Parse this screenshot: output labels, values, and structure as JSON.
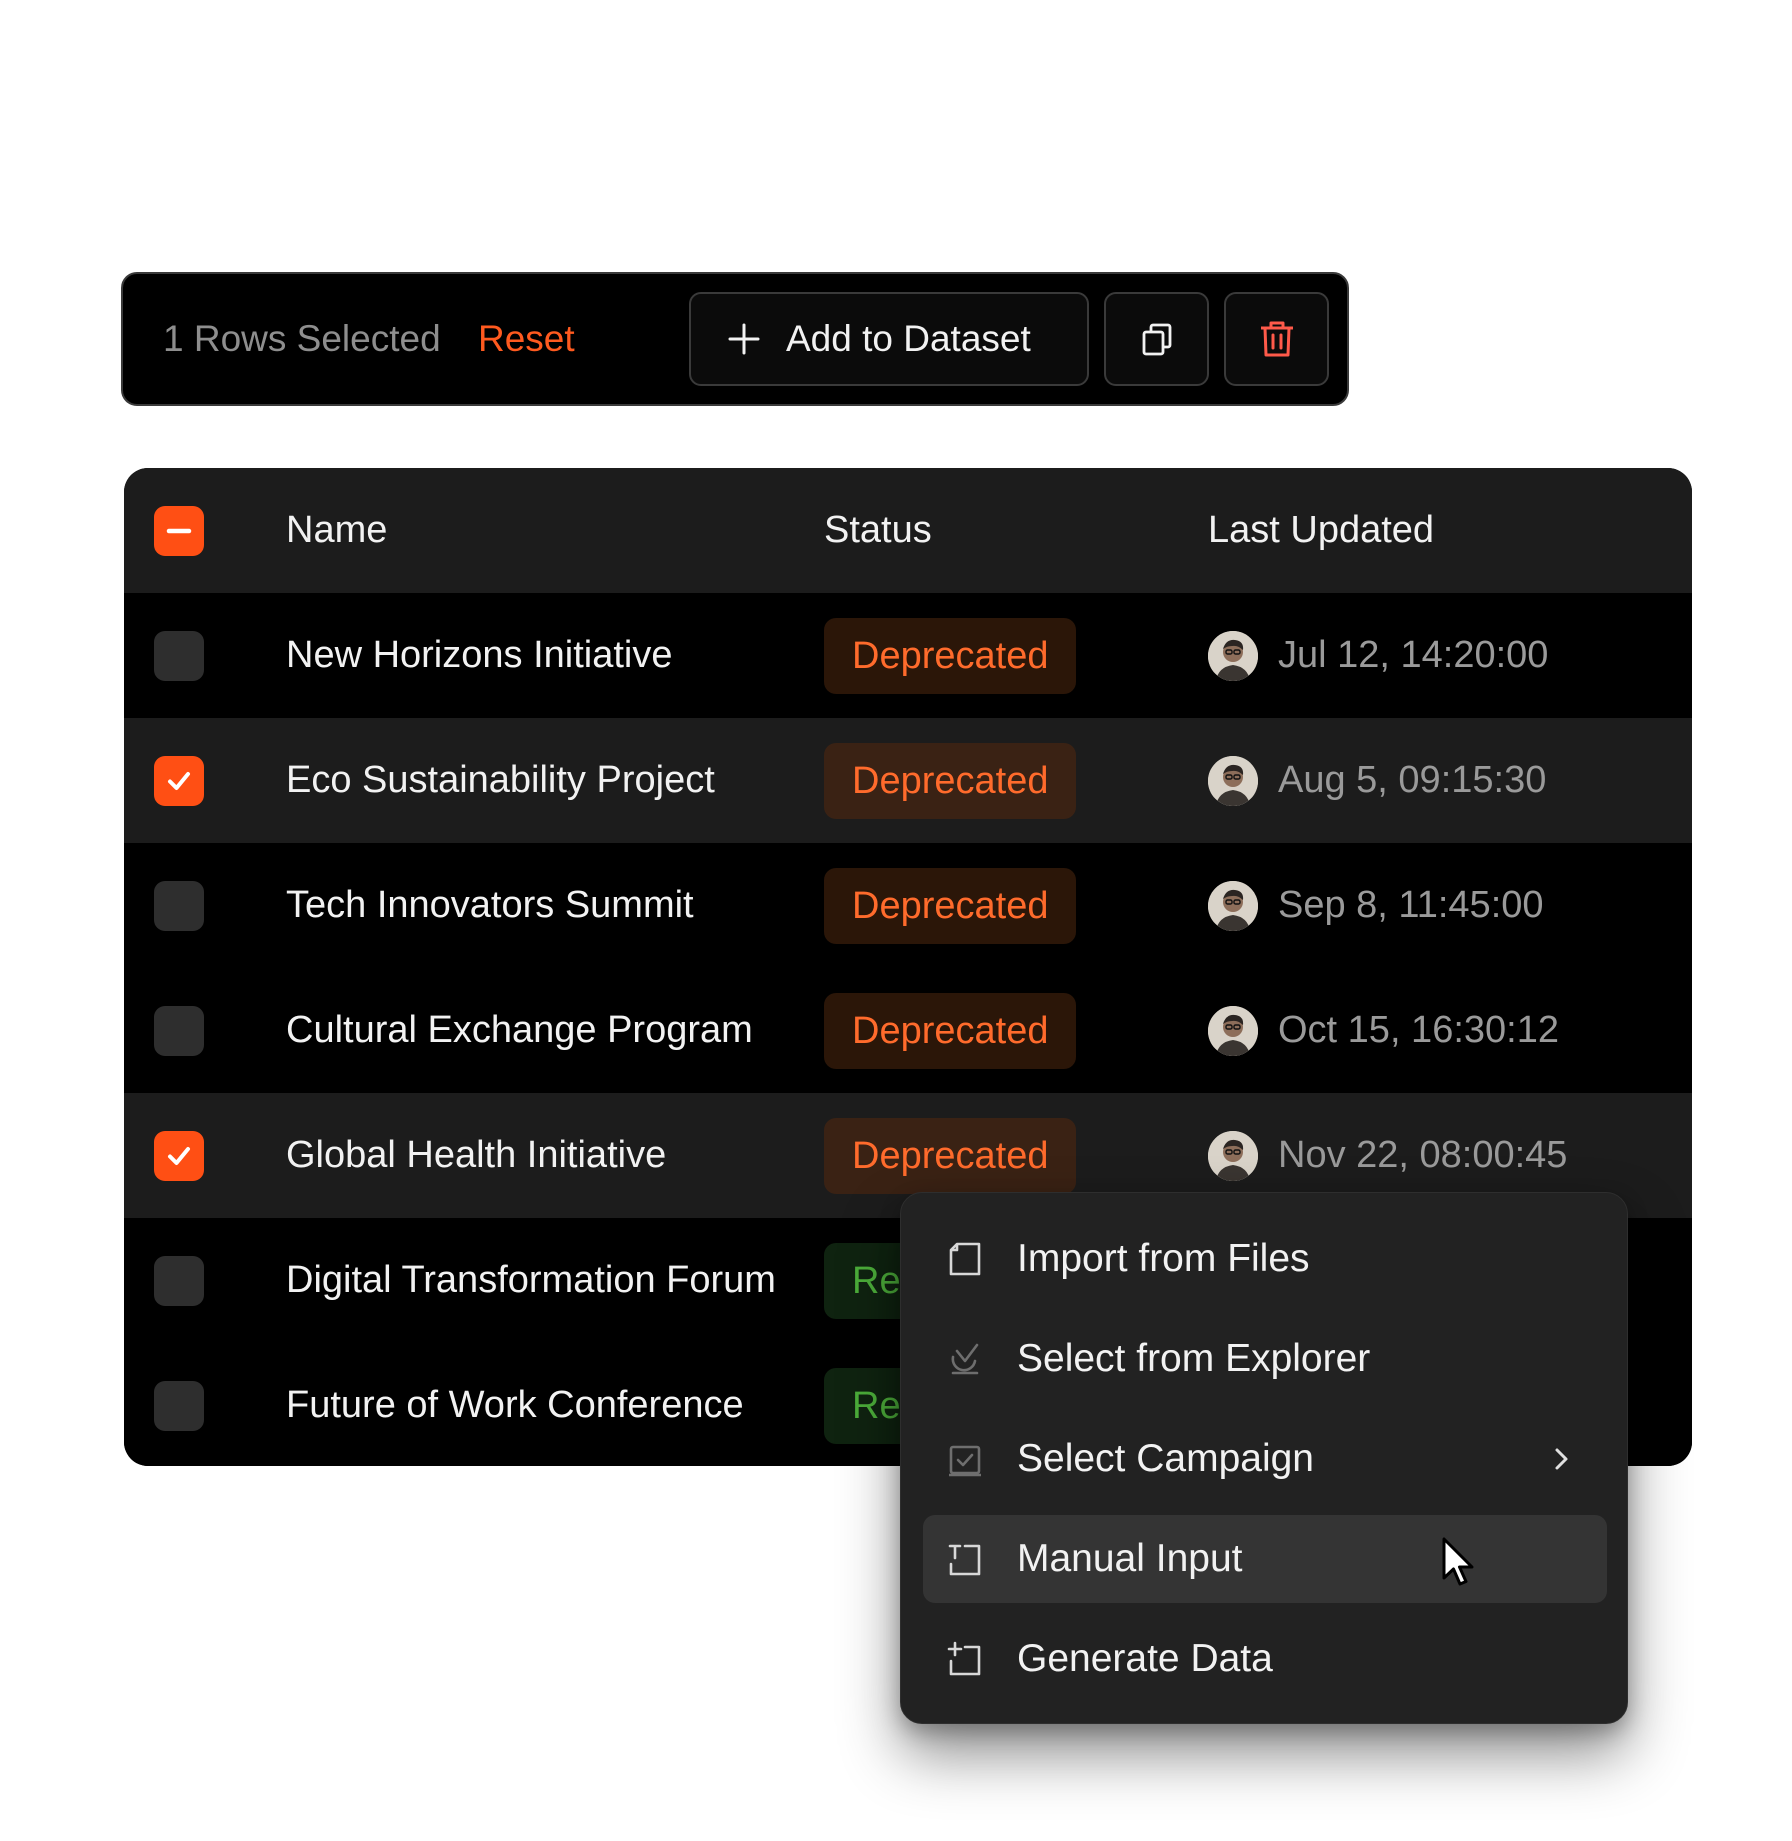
{
  "toolbar": {
    "selected_text": "1 Rows Selected",
    "reset_label": "Reset",
    "add_label": "Add to Dataset",
    "delete_color": "#ff5a4a",
    "accent": "#ff5a1f"
  },
  "table": {
    "headers": {
      "name": "Name",
      "status": "Status",
      "updated": "Last Updated"
    },
    "rows": [
      {
        "name": "New Horizons Initiative",
        "status": "Deprecated",
        "date": "Jul 12, 14:20:00",
        "checked": false
      },
      {
        "name": "Eco Sustainability Project",
        "status": "Deprecated",
        "date": "Aug 5, 09:15:30",
        "checked": true
      },
      {
        "name": "Tech Innovators Summit",
        "status": "Deprecated",
        "date": "Sep 8, 11:45:00",
        "checked": false
      },
      {
        "name": "Cultural Exchange Program",
        "status": "Deprecated",
        "date": "Oct 15, 16:30:12",
        "checked": false
      },
      {
        "name": "Global Health Initiative",
        "status": "Deprecated",
        "date": "Nov 22, 08:00:45",
        "checked": true
      },
      {
        "name": "Digital Transformation Forum",
        "status": "Rel",
        "date": "",
        "checked": false
      },
      {
        "name": "Future of Work Conference",
        "status": "Rel",
        "date": "",
        "checked": false
      }
    ]
  },
  "menu": {
    "items": [
      {
        "label": "Import from Files",
        "icon": "file-icon"
      },
      {
        "label": "Select from Explorer",
        "icon": "explorer-icon"
      },
      {
        "label": "Select Campaign",
        "icon": "campaign-icon",
        "submenu": true
      },
      {
        "label": "Manual Input",
        "icon": "manual-input-icon",
        "hovered": true
      },
      {
        "label": "Generate Data",
        "icon": "generate-icon"
      }
    ]
  }
}
